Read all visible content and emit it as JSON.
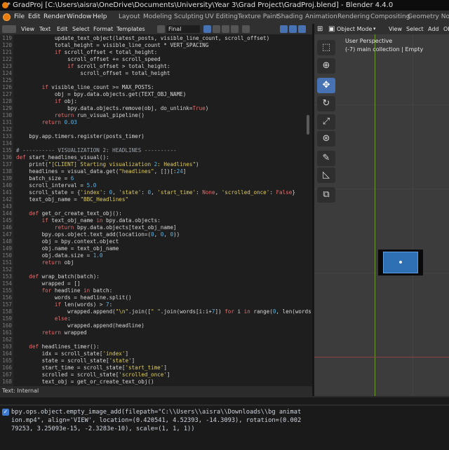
{
  "window_title": "* GradProj [C:\\Users\\aisra\\OneDrive\\Documents\\University\\Year 3\\Grad Project\\GradProj.blend] - Blender 4.4.0",
  "menu": [
    "File",
    "Edit",
    "Render",
    "Window",
    "Help"
  ],
  "workspaces": [
    "Layout",
    "Modeling",
    "Sculpting",
    "UV Editing",
    "Texture Paint",
    "Shading",
    "Animation",
    "Rendering",
    "Compositing",
    "Geometry Nodes"
  ],
  "text_editor": {
    "menu": [
      "View",
      "Text",
      "Edit",
      "Select",
      "Format",
      "Templates"
    ],
    "file_name": "Final",
    "status": "Text: Internal"
  },
  "code_lines": [
    {
      "n": "119",
      "t": "            update_text_object(latest_posts, visible_line_count, scroll_offset)"
    },
    {
      "n": "120",
      "t": "            total_height = visible_line_count * VERT_SPACING"
    },
    {
      "n": "121",
      "t": "            if scroll_offset < total_height:"
    },
    {
      "n": "122",
      "t": "                scroll_offset += scroll_speed"
    },
    {
      "n": "123",
      "t": "                if scroll_offset > total_height:"
    },
    {
      "n": "124",
      "t": "                    scroll_offset = total_height"
    },
    {
      "n": "125",
      "t": ""
    },
    {
      "n": "126",
      "t": "        if visible_line_count >= MAX_POSTS:"
    },
    {
      "n": "127",
      "t": "            obj = bpy.data.objects.get(TEXT_OBJ_NAME)"
    },
    {
      "n": "128",
      "t": "            if obj:"
    },
    {
      "n": "129",
      "t": "                bpy.data.objects.remove(obj, do_unlink=True)"
    },
    {
      "n": "130",
      "t": "            return run_visual_pipeline()"
    },
    {
      "n": "131",
      "t": "        return 0.03"
    },
    {
      "n": "132",
      "t": ""
    },
    {
      "n": "133",
      "t": "    bpy.app.timers.register(posts_timer)"
    },
    {
      "n": "134",
      "t": ""
    },
    {
      "n": "135",
      "t": "# ---------- VISUALIZATION 2: HEADLINES ----------"
    },
    {
      "n": "136",
      "t": "def start_headlines_visual():"
    },
    {
      "n": "137",
      "t": "    print(\"[CLIENT] Starting visualization 2: Headlines\")"
    },
    {
      "n": "138",
      "t": "    headlines = visual_data.get(\"headlines\", [])[:24]"
    },
    {
      "n": "139",
      "t": "    batch_size = 6"
    },
    {
      "n": "140",
      "t": "    scroll_interval = 5.0"
    },
    {
      "n": "141",
      "t": "    scroll_state = {'index': 0, 'state': 0, 'start_time': None, 'scrolled_once': False}"
    },
    {
      "n": "142",
      "t": "    text_obj_name = \"BBC_Headlines\""
    },
    {
      "n": "143",
      "t": ""
    },
    {
      "n": "144",
      "t": "    def get_or_create_text_obj():"
    },
    {
      "n": "145",
      "t": "        if text_obj_name in bpy.data.objects:"
    },
    {
      "n": "146",
      "t": "            return bpy.data.objects[text_obj_name]"
    },
    {
      "n": "147",
      "t": "        bpy.ops.object.text_add(location=(0, 0, 0))"
    },
    {
      "n": "148",
      "t": "        obj = bpy.context.object"
    },
    {
      "n": "149",
      "t": "        obj.name = text_obj_name"
    },
    {
      "n": "150",
      "t": "        obj.data.size = 1.0"
    },
    {
      "n": "151",
      "t": "        return obj"
    },
    {
      "n": "152",
      "t": ""
    },
    {
      "n": "153",
      "t": "    def wrap_batch(batch):"
    },
    {
      "n": "154",
      "t": "        wrapped = []"
    },
    {
      "n": "155",
      "t": "        for headline in batch:"
    },
    {
      "n": "156",
      "t": "            words = headline.split()"
    },
    {
      "n": "157",
      "t": "            if len(words) > 7:"
    },
    {
      "n": "158",
      "t": "                wrapped.append(\"\\n\".join([\" \".join(words[i:i+7]) for i in range(0, len(words"
    },
    {
      "n": "159",
      "t": "            else:"
    },
    {
      "n": "160",
      "t": "                wrapped.append(headline)"
    },
    {
      "n": "161",
      "t": "        return wrapped"
    },
    {
      "n": "162",
      "t": ""
    },
    {
      "n": "163",
      "t": "    def headlines_timer():"
    },
    {
      "n": "164",
      "t": "        idx = scroll_state['index']"
    },
    {
      "n": "165",
      "t": "        state = scroll_state['state']"
    },
    {
      "n": "166",
      "t": "        start_time = scroll_state['start_time']"
    },
    {
      "n": "167",
      "t": "        scrolled = scroll_state['scrolled_once']"
    },
    {
      "n": "168",
      "t": "        text_obj = get_or_create_text_obj()"
    }
  ],
  "console": {
    "line1": "bpy.ops.object.empty_image_add(filepath=\"C:\\\\Users\\\\aisra\\\\Downloads\\\\bg animat",
    "line2": "ion.mp4\", align='VIEW', location=(0.420541, 4.52393, -14.3093), rotation=(0.002",
    "line3": "79253, 3.25093e-15, -2.3283e-10), scale=(1, 1, 1))"
  },
  "viewport": {
    "mode": "Object Mode",
    "menu": [
      "View",
      "Select",
      "Add",
      "Ob"
    ],
    "title": "User Perspective",
    "subtitle": "(-7) main collection | Empty"
  },
  "colors": {
    "keyword": "#e46e6e",
    "string": "#e0cc5a",
    "number": "#5ab4e6",
    "comment": "#9aa3ad",
    "accent": "#4772b3"
  }
}
